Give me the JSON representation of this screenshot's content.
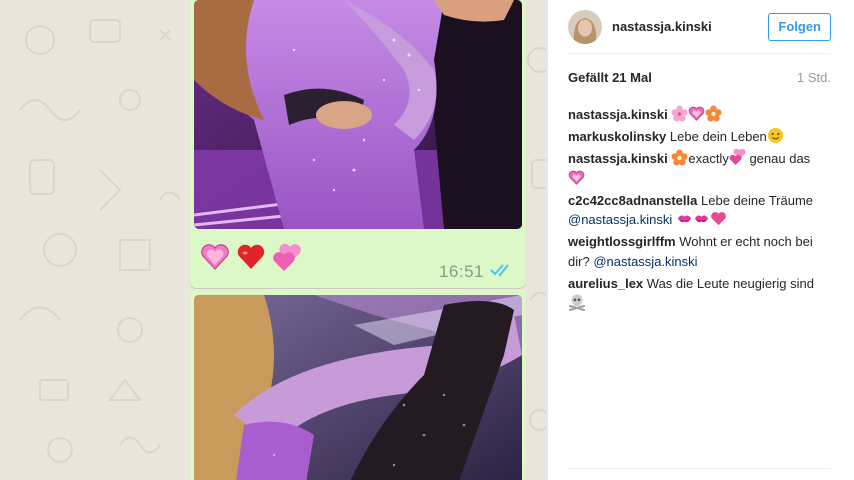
{
  "chat": {
    "message1": {
      "emojis": [
        "pink-sparkling-heart",
        "red-heart",
        "two-hearts"
      ],
      "time": "16:51",
      "status": "read-double-check"
    }
  },
  "post": {
    "username": "nastassja.kinski",
    "follow_label": "Folgen",
    "likes": "Gefällt 21 Mal",
    "time": "1 Std.",
    "comments": [
      {
        "user": "nastassja.kinski",
        "parts": [],
        "emojis": [
          "cherry-blossom",
          "sparkling-heart",
          "blossom"
        ]
      },
      {
        "user": "markuskolinsky",
        "text": "Lebe dein Leben",
        "emojis": [
          "smiley"
        ]
      },
      {
        "user": "nastassja.kinski",
        "text_a": "exactly",
        "text_b": "genau das",
        "emojis": [
          "blossom",
          "two-hearts",
          "sparkling-heart"
        ]
      },
      {
        "user": "c2c42cc8adnanstella",
        "text": "Lebe deine Träume",
        "mention": "@nastassja.kinski",
        "emojis": [
          "kiss-mark",
          "kiss-mark",
          "red-heart"
        ]
      },
      {
        "user": "weightlossgirlffm",
        "text": "Wohnt er echt noch bei dir?",
        "mention": "@nastassja.kinski"
      },
      {
        "user": "aurelius_lex",
        "text": "Was die Leute neugierig sind",
        "emojis": [
          "skull-crossbones"
        ]
      }
    ]
  },
  "colors": {
    "chat_bg": "#ece5dd",
    "bubble": "#dcf8c6",
    "follow_blue": "#3897f0",
    "mention": "#003569",
    "read_tick": "#4fc3f7"
  }
}
